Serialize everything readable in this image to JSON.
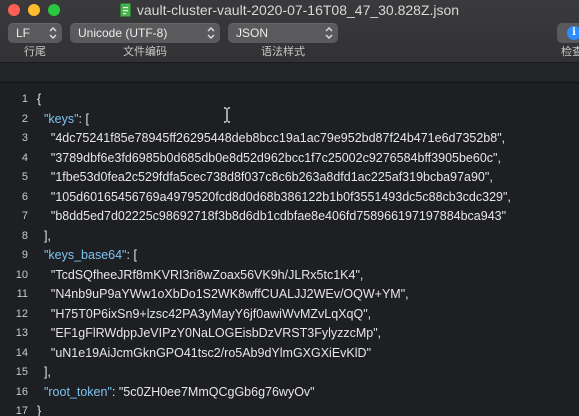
{
  "window": {
    "title": "vault-cluster-vault-2020-07-16T08_47_30.828Z.json"
  },
  "toolbar": {
    "line_ending": {
      "value": "LF",
      "label": "行尾"
    },
    "encoding": {
      "value": "Unicode (UTF-8)",
      "label": "文件编码"
    },
    "syntax": {
      "value": "JSON",
      "label": "语法样式"
    },
    "inspector": {
      "label": "检查"
    }
  },
  "editor": {
    "line_numbers": [
      "1",
      "2",
      "3",
      "4",
      "5",
      "6",
      "7",
      "8",
      "9",
      "10",
      "11",
      "12",
      "13",
      "14",
      "15",
      "16",
      "17"
    ],
    "lines": [
      "{",
      "  \"keys\": [",
      "    \"4dc75241f85e78945ff26295448deb8bcc19a1ac79e952bd87f24b471e6d7352b8\",",
      "    \"3789dbf6e3fd6985b0d685db0e8d52d962bcc1f7c25002c9276584bff3905be60c\",",
      "    \"1fbe53d0fea2c529fdfa5cec738d8f037c8c6b263a8dfd1ac225af319bcba97a90\",",
      "    \"105d60165456769a4979520fcd8d0d68b386122b1b0f3551493dc5c88cb3cdc329\",",
      "    \"b8dd5ed7d02225c98692718f3b8d6db1cdbfae8e406fd758966197197884bca943\"",
      "  ],",
      "  \"keys_base64\": [",
      "    \"TcdSQfheeJRf8mKVRI3ri8wZoax56VK9h/JLRx5tc1K4\",",
      "    \"N4nb9uP9aYWw1oXbDo1S2WK8wffCUALJJ2WEv/OQW+YM\",",
      "    \"H75T0P6ixSn9+lzsc42PA3yMayY6jf0awiWvMZvLqXqQ\",",
      "    \"EF1gFlRWdppJeVIPzY0NaLOGEisbDzVRST3FylyzzcMp\",",
      "    \"uN1e19AiJcmGknGPO41tsc2/ro5Ab9dYlmGXGXiEvKlD\"",
      "  ],",
      "  \"root_token\": \"5c0ZH0ee7MmQCgGb6g76wyOv\"",
      "}"
    ]
  },
  "colors": {
    "background": "#1e1f22",
    "toolbar": "#3a3a3c",
    "text": "#e6e6e6",
    "key": "#7cc4f0"
  }
}
